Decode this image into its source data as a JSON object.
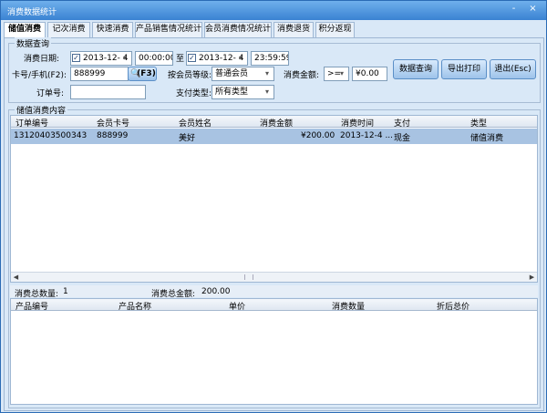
{
  "window": {
    "title": "消费数据统计",
    "minimize": "-",
    "close": "×"
  },
  "tabs": [
    "储值消费",
    "记次消费",
    "快速消费",
    "产品销售情况统计",
    "会员消费情况统计",
    "消费退货",
    "积分返现"
  ],
  "query": {
    "legend": "数据查询",
    "date_label": "消费日期:",
    "start_date": "2013-12- 4",
    "start_time": "00:00:00",
    "to_label": "至",
    "end_date": "2013-12- 4",
    "end_time": "23:59:59",
    "card_label": "卡号/手机(F2):",
    "card_value": "888999",
    "f3_label": "(F3)",
    "level_label": "按会员等级:",
    "level_value": "普通会员",
    "amount_label": "消费金额:",
    "amount_op": ">=",
    "amount_value": "¥0.00",
    "order_label": "订单号:",
    "order_value": "",
    "pay_label": "支付类型:",
    "pay_value": "所有类型",
    "btn_query": "数据查询",
    "btn_export": "导出打印",
    "btn_exit": "退出(Esc)"
  },
  "content": {
    "legend": "储值消费内容",
    "columns": [
      "订单编号",
      "会员卡号",
      "会员姓名",
      "消费金额",
      "消费时间",
      "支付",
      "类型"
    ],
    "rows": [
      {
        "order": "13120403500343",
        "card": "888999",
        "name": "美好",
        "amount": "¥200.00",
        "time": "2013-12-4 ...",
        "pay": "现金",
        "type": "储值消费"
      }
    ]
  },
  "summary": {
    "count_label": "消费总数量:",
    "count_value": "1",
    "total_label": "消费总金额:",
    "total_value": "200.00"
  },
  "detail": {
    "columns": [
      "产品编号",
      "产品名称",
      "单价",
      "消费数量",
      "折后总价"
    ]
  }
}
